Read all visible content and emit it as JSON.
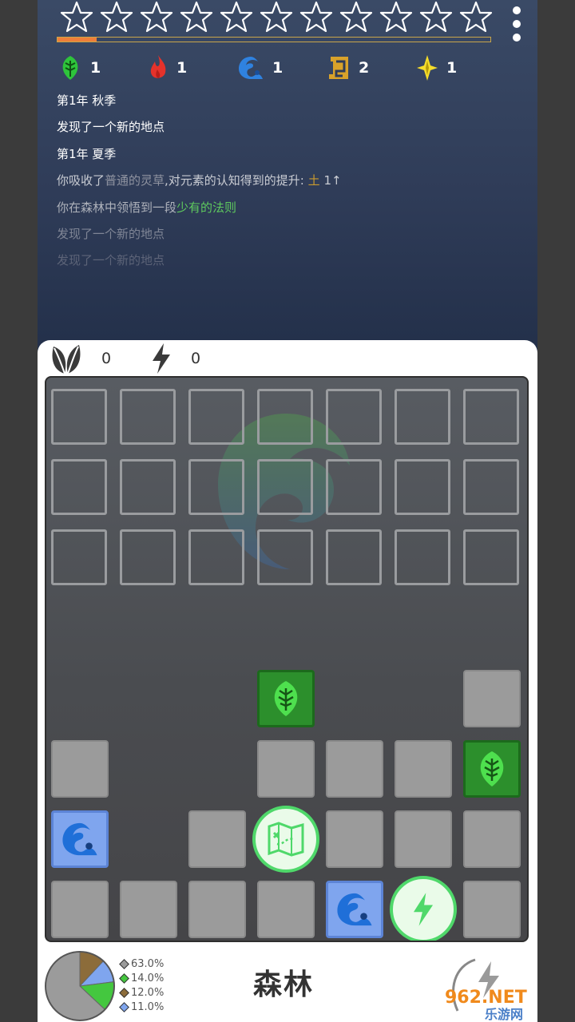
{
  "stars": {
    "count": 11,
    "filled": 0
  },
  "progress": {
    "fraction": 0.09
  },
  "resources": [
    {
      "icon": "wood-element-icon",
      "count": "1",
      "color": "#2ec43b"
    },
    {
      "icon": "fire-element-icon",
      "count": "1",
      "color": "#e5322b"
    },
    {
      "icon": "water-element-icon",
      "count": "1",
      "color": "#2f82e0"
    },
    {
      "icon": "earth-element-icon",
      "count": "2",
      "color": "#d9a22a"
    },
    {
      "icon": "metal-element-icon",
      "count": "1",
      "color": "#f5dd2a"
    }
  ],
  "log": {
    "line1": "第1年 秋季",
    "line2": "发现了一个新的地点",
    "line3": "第1年 夏季",
    "line4_a": "你吸收了",
    "line4_b": "普通的灵草",
    "line4_c": ",对元素的认知得到的提升:",
    "line4_d": "土",
    "line4_e": "1↑",
    "line5_a": "你在森林中领悟到一段",
    "line5_b": "少有的法则",
    "line6": "发现了一个新的地点",
    "line7": "发现了一个新的地点"
  },
  "counters": {
    "leaf": "0",
    "energy": "0"
  },
  "area_name": "森林",
  "chart_data": {
    "type": "pie",
    "values": [
      63.0,
      14.0,
      12.0,
      11.0
    ],
    "labels": [
      "63.0%",
      "14.0%",
      "12.0%",
      "11.0%"
    ],
    "colors": [
      "#9b9b9b",
      "#44c73f",
      "#8c6c3a",
      "#7fa5ee"
    ]
  },
  "brand": {
    "text": "962.NET",
    "sub": "乐游网"
  }
}
